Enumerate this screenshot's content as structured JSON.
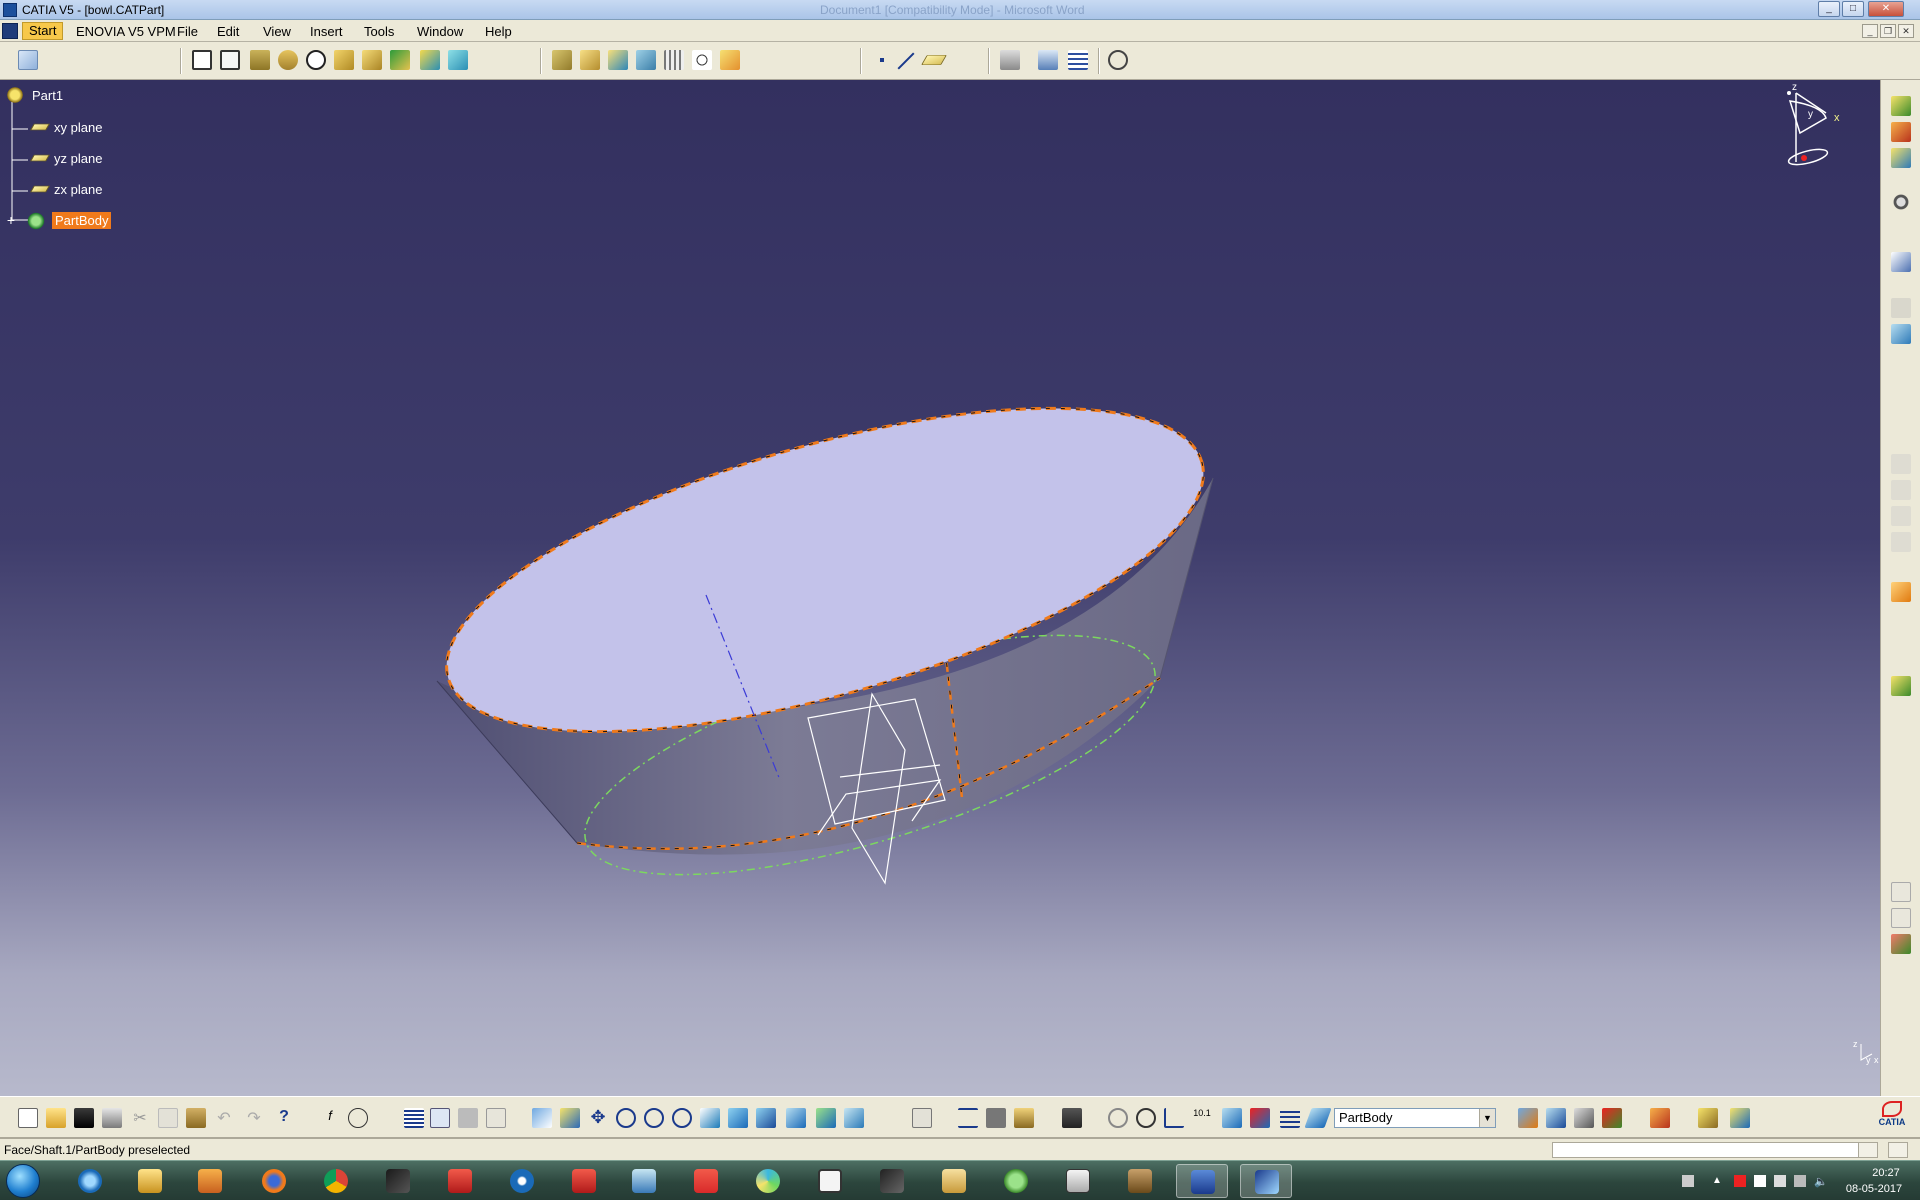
{
  "window": {
    "title": "CATIA V5 - [bowl.CATPart]",
    "background_title": "Document1 [Compatibility Mode] - Microsoft Word",
    "controls": {
      "minimize": "_",
      "maximize": "□",
      "close": "✕"
    }
  },
  "menu": {
    "items": [
      {
        "label": "Start"
      },
      {
        "label": "ENOVIA V5 VPM"
      },
      {
        "label": "File"
      },
      {
        "label": "Edit"
      },
      {
        "label": "View"
      },
      {
        "label": "Insert"
      },
      {
        "label": "Tools"
      },
      {
        "label": "Window"
      },
      {
        "label": "Help"
      }
    ],
    "mdi_controls": {
      "minimize": "_",
      "restore": "❐",
      "close": "✕"
    }
  },
  "toolbar_top": {
    "icons": [
      "workbench-icon",
      "sketch-icon",
      "positioned-sketch-icon",
      "pad-icon",
      "pocket-icon",
      "shaft-icon",
      "groove-icon",
      "hole-icon",
      "rib-icon",
      "slot-icon",
      "stiffener-icon",
      "multi-section-solid-icon",
      "fillet-icon",
      "chamfer-icon",
      "draft-icon",
      "shell-icon",
      "thickness-icon",
      "thread-icon",
      "remove-face-icon",
      "replace-face-icon",
      "point-icon",
      "line-icon",
      "plane-icon",
      "axis-system-icon",
      "tolerance-icon",
      "grid-icon",
      "catalog-icon"
    ]
  },
  "spec_tree": {
    "root": "Part1",
    "items": [
      {
        "label": "xy plane",
        "icon": "plane-icon"
      },
      {
        "label": "yz plane",
        "icon": "plane-icon"
      },
      {
        "label": "zx plane",
        "icon": "plane-icon"
      },
      {
        "label": "PartBody",
        "icon": "partbody-icon",
        "selected": true
      }
    ]
  },
  "compass": {
    "axis_x": "x",
    "axis_y": "y",
    "axis_z": "z"
  },
  "mini_axis": {
    "axis_z": "z",
    "axis_y": "y",
    "axis_x": "x"
  },
  "toolbar_bottom": {
    "body_select_value": "PartBody",
    "logo_text": "CATIA",
    "icons": [
      "new-icon",
      "open-icon",
      "save-icon",
      "print-icon",
      "cut-icon",
      "copy-icon",
      "paste-icon",
      "undo-icon",
      "redo-icon",
      "whats-this-icon",
      "formula-icon",
      "knowledge-icon",
      "design-table-icon",
      "law-icon",
      "measure-icon",
      "fly-mode-icon",
      "fit-all-icon",
      "pan-icon",
      "rotate-icon",
      "zoom-in-icon",
      "zoom-out-icon",
      "normal-view-icon",
      "quick-view-icon",
      "view-mode-icon",
      "hide-show-icon",
      "swap-space-icon",
      "apply-material-icon",
      "measure-between-icon",
      "measure-item-icon",
      "measure-inertia-icon",
      "capture-icon",
      "update-icon",
      "axis-system-icon",
      "snap-point-icon",
      "scale-icon",
      "3d-constraint-icon"
    ]
  },
  "status": {
    "text": "Face/Shaft.1/PartBody preselected"
  },
  "taskbar": {
    "clock_time": "20:27",
    "clock_date": "08-05-2017",
    "apps": [
      "internet-explorer-icon",
      "file-explorer-icon",
      "media-player-icon",
      "firefox-icon",
      "chrome-icon",
      "catia-icon",
      "foxit-icon",
      "teamviewer-icon",
      "acrobat-icon",
      "remote-desktop-icon",
      "pdf-icon",
      "paint-icon",
      "sticky-notes-icon",
      "3d-app-icon",
      "book-icon",
      "vlc-icon",
      "presentation-icon",
      "winrar-icon",
      "word-icon",
      "catia-active-icon"
    ]
  },
  "colors": {
    "viewport_top": "#33305f",
    "viewport_bottom": "#b7b9cc",
    "selection": "#f07a1b",
    "highlight_edge": "#f07a1b",
    "green_edge": "#7cd85f",
    "top_face": "#c3c2ea",
    "side_face": "#6a6985"
  }
}
